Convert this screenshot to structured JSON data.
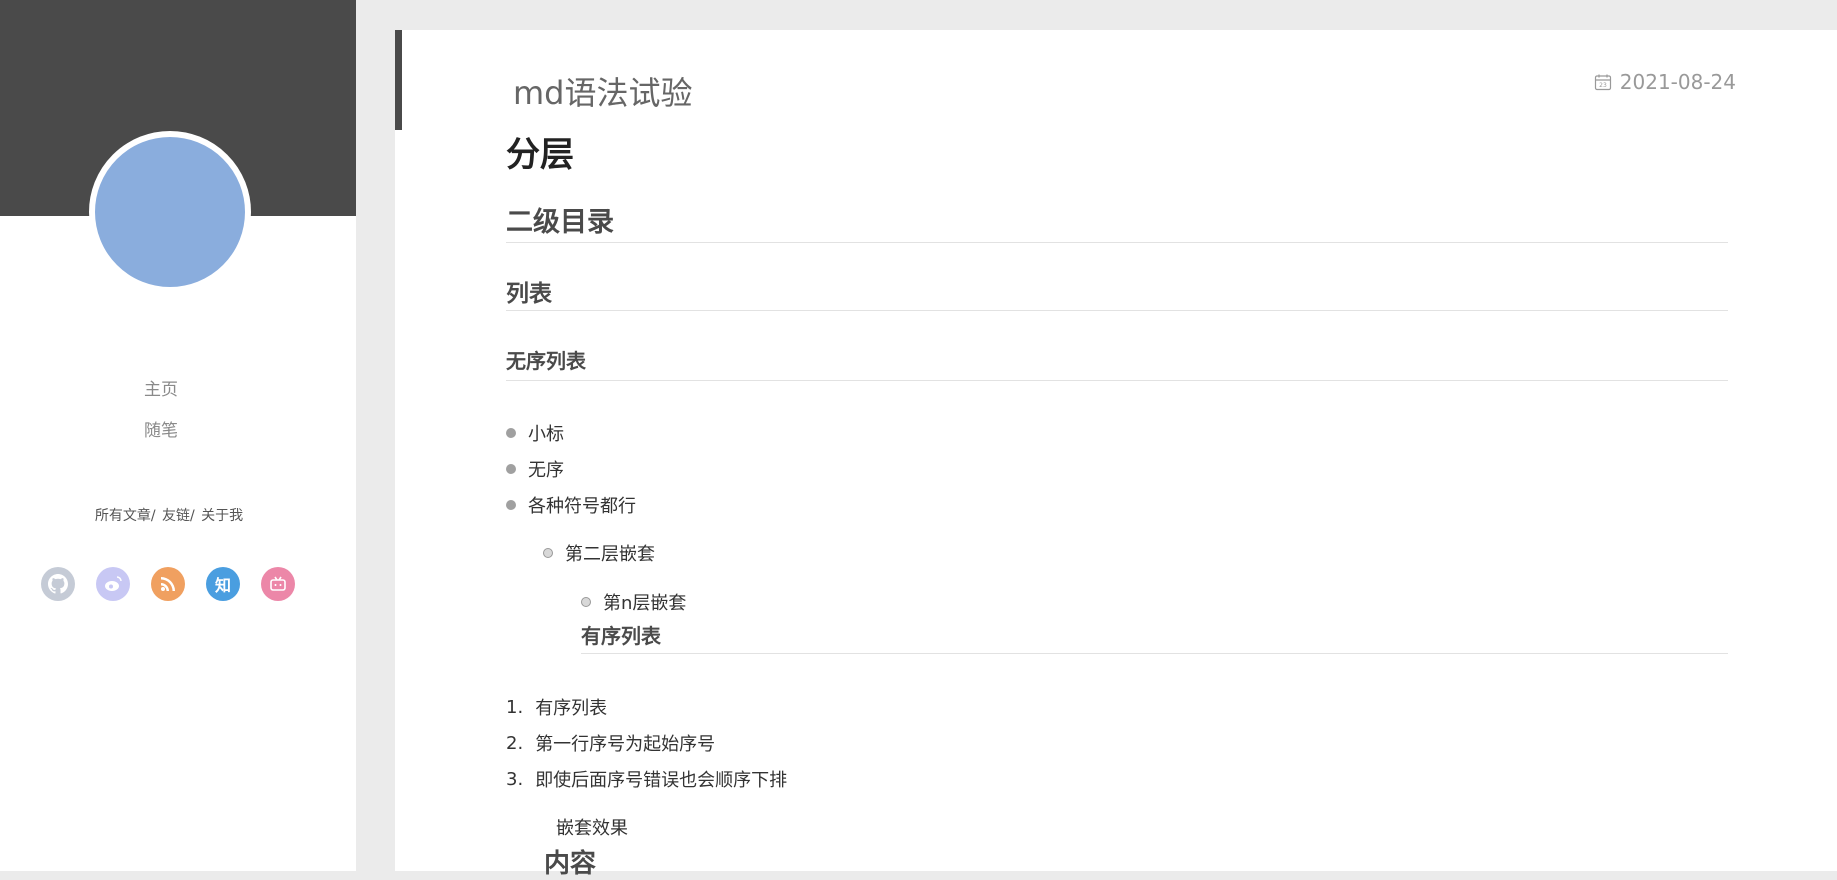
{
  "sidebar": {
    "nav": [
      "主页",
      "随笔"
    ],
    "links": [
      "所有文章/",
      "友链/",
      "关于我"
    ],
    "social": [
      {
        "icon": "github-icon",
        "color": "#c5cbd6"
      },
      {
        "icon": "weibo-icon",
        "color": "#c8c8f4"
      },
      {
        "icon": "rss-icon",
        "color": "#f0a060"
      },
      {
        "icon": "zhihu-icon",
        "color": "#4a9ee0",
        "label": "知"
      },
      {
        "icon": "bilibili-icon",
        "color": "#ec87a8"
      }
    ]
  },
  "post": {
    "title": "md语法试验",
    "date": "2021-08-24",
    "h1": "分层",
    "h2": "二级目录",
    "h3": "列表",
    "h4a": "无序列表",
    "ul": [
      "小标",
      "无序",
      "各种符号都行"
    ],
    "nested1": "第二层嵌套",
    "nested2": "第n层嵌套",
    "h4b": "有序列表",
    "ol": [
      "有序列表",
      "第一行序号为起始序号",
      "即使后面序号错误也会顺序下排"
    ],
    "ol_nums": [
      "1.",
      "2.",
      "3."
    ],
    "nest_effect": "嵌套效果",
    "content_heading": "内容"
  }
}
